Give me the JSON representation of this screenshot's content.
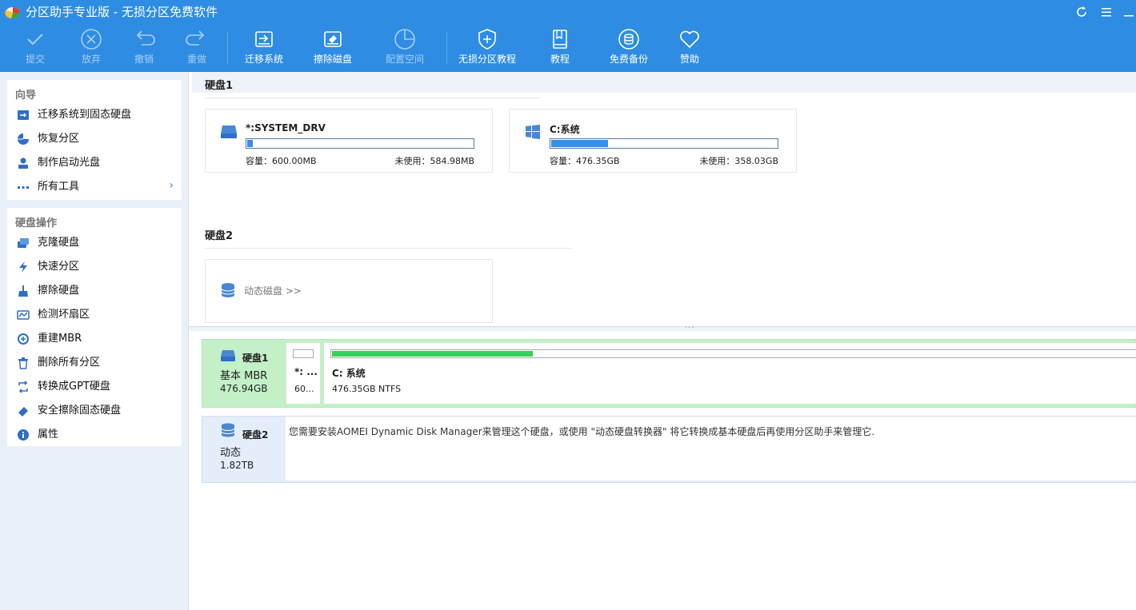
{
  "app": {
    "title": "分区助手专业版 - 无损分区免费软件"
  },
  "toolbar": {
    "items": [
      {
        "label": "提交",
        "icon": "check-icon",
        "enabled": false
      },
      {
        "label": "放弃",
        "icon": "cancel-circle-icon",
        "enabled": false
      },
      {
        "label": "撤销",
        "icon": "undo-icon",
        "enabled": false
      },
      {
        "label": "重做",
        "icon": "redo-icon",
        "enabled": false
      },
      {
        "label": "迁移系统",
        "icon": "migrate-os-icon",
        "enabled": true
      },
      {
        "label": "擦除磁盘",
        "icon": "wipe-disk-icon",
        "enabled": true
      },
      {
        "label": "配置空间",
        "icon": "allocate-space-icon",
        "enabled": false
      },
      {
        "label": "无损分区教程",
        "icon": "shield-plus-icon",
        "enabled": true
      },
      {
        "label": "教程",
        "icon": "book-icon",
        "enabled": true
      },
      {
        "label": "免费备份",
        "icon": "backup-icon",
        "enabled": true
      },
      {
        "label": "赞助",
        "icon": "heart-icon",
        "enabled": true
      }
    ]
  },
  "sidebar": {
    "wizard": {
      "heading": "向导",
      "items": [
        {
          "label": "迁移系统到固态硬盘",
          "icon": "migrate-ssd-icon"
        },
        {
          "label": "恢复分区",
          "icon": "restore-partition-icon"
        },
        {
          "label": "制作启动光盘",
          "icon": "bootable-media-icon"
        },
        {
          "label": "所有工具",
          "icon": "more-dots-icon"
        }
      ]
    },
    "disk_ops": {
      "heading": "硬盘操作",
      "items": [
        {
          "label": "克隆硬盘",
          "icon": "clone-disk-icon"
        },
        {
          "label": "快速分区",
          "icon": "lightning-icon"
        },
        {
          "label": "擦除硬盘",
          "icon": "broom-icon"
        },
        {
          "label": "检测坏扇区",
          "icon": "surface-test-icon"
        },
        {
          "label": "重建MBR",
          "icon": "rebuild-mbr-icon"
        },
        {
          "label": "删除所有分区",
          "icon": "trash-icon"
        },
        {
          "label": "转换成GPT硬盘",
          "icon": "convert-icon"
        },
        {
          "label": "安全擦除固态硬盘",
          "icon": "eraser-icon"
        },
        {
          "label": "属性",
          "icon": "info-icon"
        }
      ]
    }
  },
  "disks_view": {
    "disk1": {
      "title": "硬盘1",
      "partitions": [
        {
          "name": "*:SYSTEM_DRV",
          "capacity": "容量：600.00MB",
          "free": "未使用：584.98MB",
          "used_fraction": 0.025
        },
        {
          "name": "C:系统",
          "capacity": "容量：476.35GB",
          "free": "未使用：358.03GB",
          "used_fraction": 0.25
        }
      ]
    },
    "disk2": {
      "title": "硬盘2",
      "dynamic_label": "动态磁盘 >>"
    }
  },
  "disk_map": {
    "disk1": {
      "name": "硬盘1",
      "type": "基本 MBR",
      "size": "476.94GB",
      "partitions": [
        {
          "name": "*: ...",
          "sub": "60..."
        },
        {
          "name": "C: 系统",
          "sub": "476.35GB NTFS",
          "used_fraction": 0.25
        }
      ]
    },
    "disk2": {
      "name": "硬盘2",
      "type": "动态",
      "size": "1.82TB",
      "message": "您需要安装AOMEI Dynamic Disk Manager来管理这个硬盘，或使用 \"动态硬盘转换器\" 将它转换成基本硬盘后再使用分区助手来管理它."
    }
  },
  "colors": {
    "accent": "#2e8de2",
    "used_bar": "#3b8ee6",
    "map_used": "#37d05a",
    "map_selected": "#c3f0c6"
  }
}
